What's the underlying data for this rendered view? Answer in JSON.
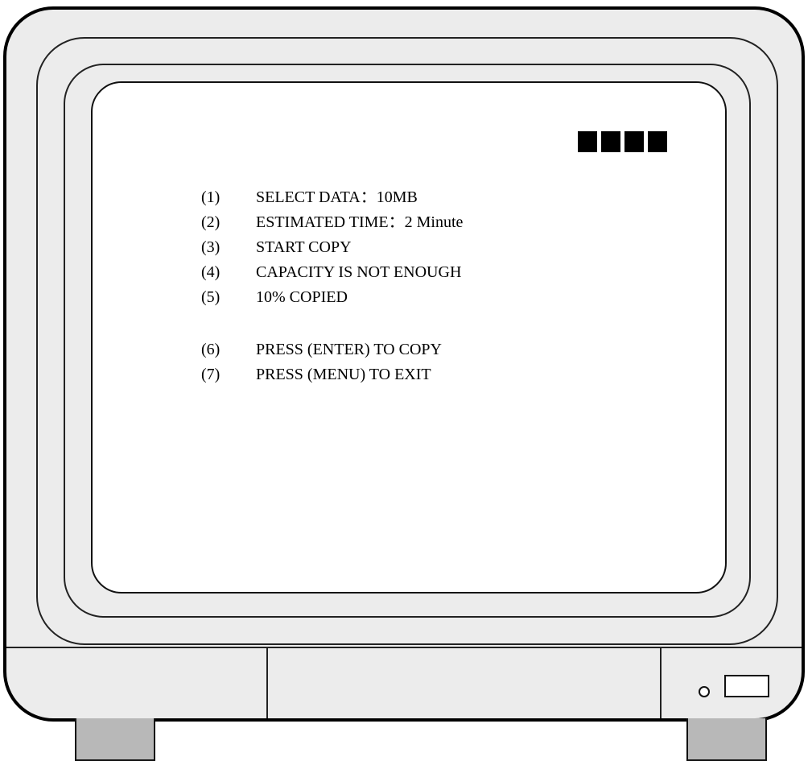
{
  "osd": {
    "indicator_blocks": 4,
    "items": [
      {
        "num": "(1)",
        "text": "SELECT DATA：10MB"
      },
      {
        "num": "(2)",
        "text": "ESTIMATED TIME：2 Minute"
      },
      {
        "num": "(3)",
        "text": "START COPY"
      },
      {
        "num": "(4)",
        "text": "CAPACITY IS NOT ENOUGH"
      },
      {
        "num": "(5)",
        "text": "10% COPIED"
      },
      {
        "num": "(6)",
        "text": "PRESS (ENTER) TO COPY"
      },
      {
        "num": "(7)",
        "text": "PRESS (MENU) TO EXIT"
      }
    ]
  },
  "device": {
    "power_led_icon": "led-indicator-icon",
    "power_button_icon": "power-button-icon"
  }
}
